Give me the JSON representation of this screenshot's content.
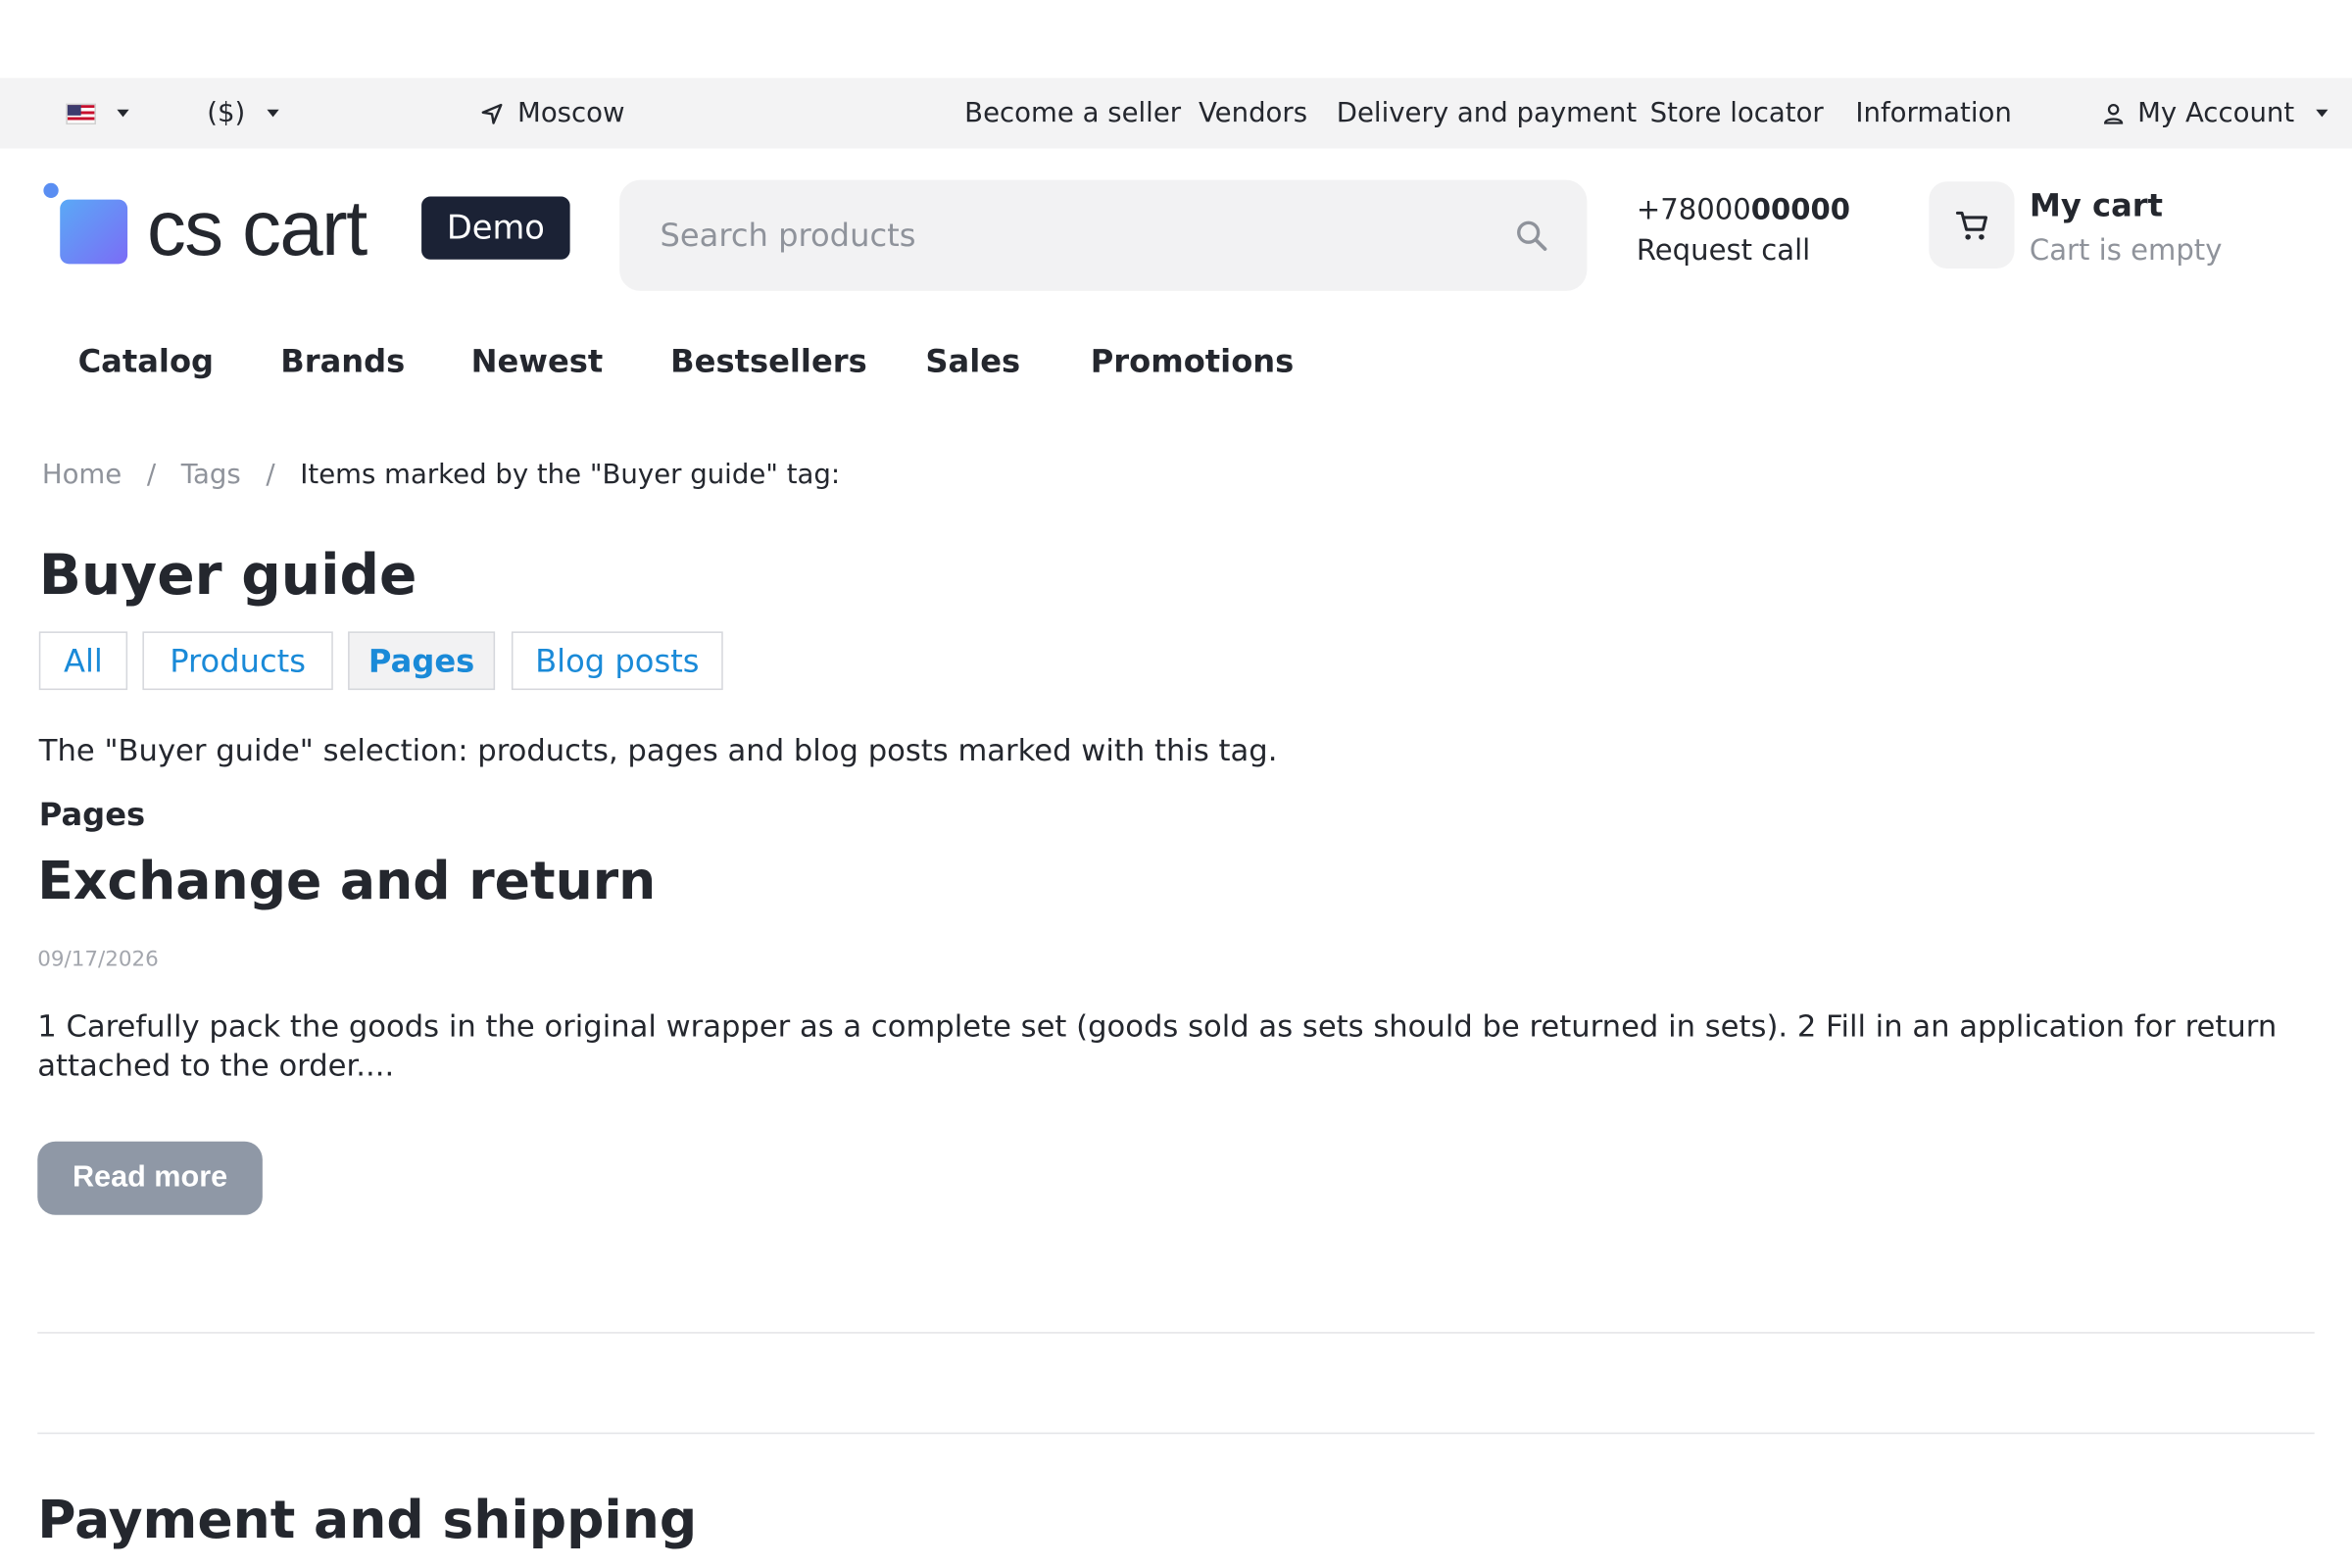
{
  "topbar": {
    "language_icon": "us-flag-icon",
    "currency": "($)",
    "location": "Moscow",
    "links": [
      "Become a seller",
      "Vendors",
      "Delivery and payment",
      "Store locator",
      "Information"
    ],
    "account": "My Account"
  },
  "header": {
    "logo_text": "cs cart",
    "demo_badge": "Demo",
    "search_placeholder": "Search products",
    "phone_prefix": "+78000",
    "phone_bold": "00000",
    "request_call": "Request call",
    "cart_title": "My cart",
    "cart_status": "Cart is empty"
  },
  "menu": [
    "Catalog",
    "Brands",
    "Newest",
    "Bestsellers",
    "Sales",
    "Promotions"
  ],
  "breadcrumbs": {
    "home": "Home",
    "separator": "/",
    "tags": "Tags",
    "current": "Items marked by the \"Buyer guide\" tag:"
  },
  "page": {
    "title": "Buyer guide",
    "tabs": [
      "All",
      "Products",
      "Pages",
      "Blog posts"
    ],
    "active_tab": "Pages",
    "intro": "The \"Buyer guide\" selection: products, pages and blog posts marked with this tag.",
    "section_title": "Pages"
  },
  "posts": [
    {
      "title": "Exchange and return",
      "date": "09/17/2026",
      "excerpt": "1 Carefully pack the goods in the original wrapper as a complete set (goods sold as sets should be returned in sets). 2 Fill in an application for return attached to the order....",
      "button": "Read more"
    },
    {
      "title": "Payment and shipping"
    }
  ],
  "colors": {
    "link_blue": "#1a8ad8",
    "demo_badge_bg": "#1b2235",
    "read_more_bg": "#8f98a6",
    "topbar_bg": "#f3f3f4"
  }
}
